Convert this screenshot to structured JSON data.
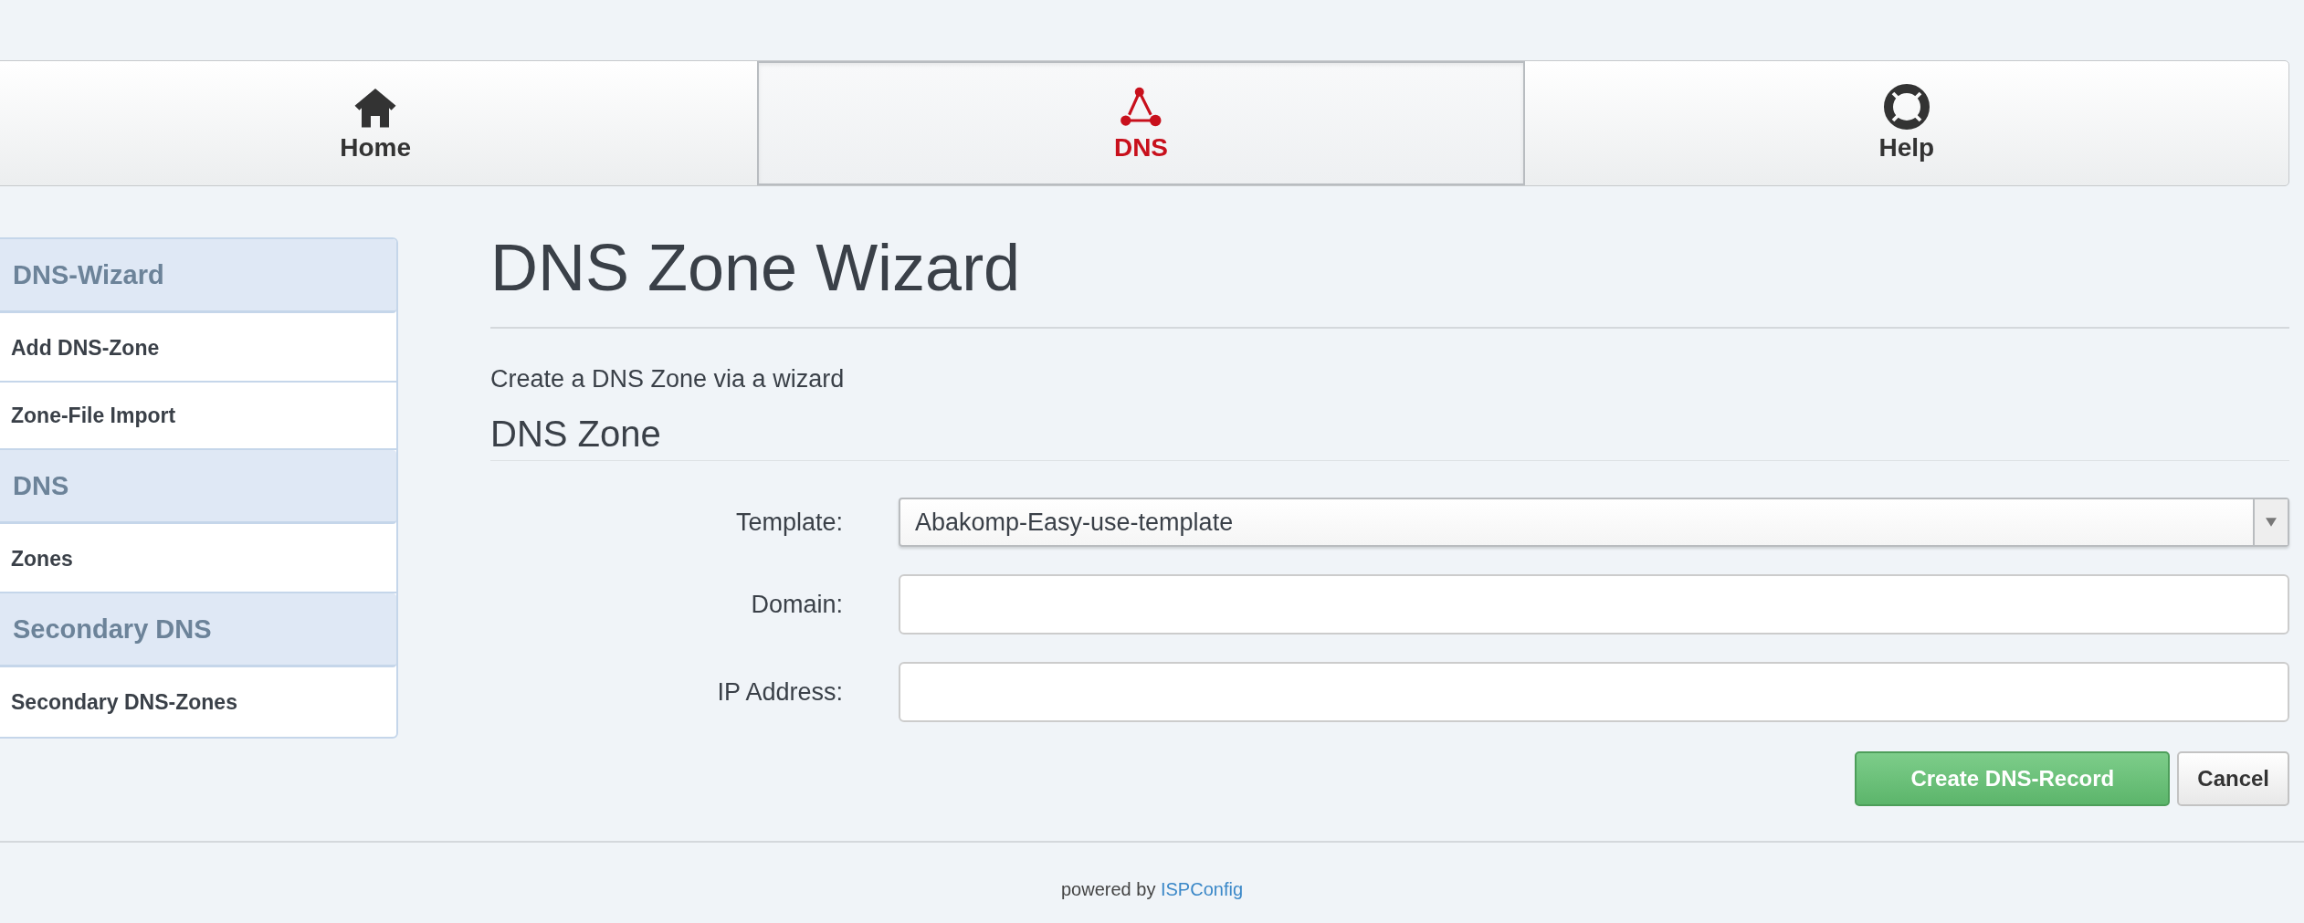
{
  "nav": {
    "tabs": [
      {
        "label": "Home",
        "selected": false
      },
      {
        "label": "DNS",
        "selected": true
      },
      {
        "label": "Help",
        "selected": false
      }
    ]
  },
  "sidebar": {
    "items": [
      {
        "kind": "header",
        "label": "DNS-Wizard"
      },
      {
        "kind": "link",
        "label": "Add DNS-Zone"
      },
      {
        "kind": "link",
        "label": "Zone-File Import"
      },
      {
        "kind": "header",
        "label": "DNS"
      },
      {
        "kind": "link",
        "label": "Zones"
      },
      {
        "kind": "header",
        "label": "Secondary DNS"
      },
      {
        "kind": "link",
        "label": "Secondary DNS-Zones"
      }
    ]
  },
  "page": {
    "title": "DNS Zone Wizard",
    "description": "Create a DNS Zone via a wizard",
    "section": "DNS Zone"
  },
  "form": {
    "fields": [
      {
        "kind": "select",
        "label": "Template:",
        "value": "Abakomp-Easy-use-template"
      },
      {
        "kind": "text",
        "label": "Domain:"
      },
      {
        "kind": "text",
        "label": "IP Address:"
      }
    ],
    "buttons": [
      {
        "kind": "primary",
        "label": "Create DNS-Record"
      },
      {
        "kind": "default",
        "label": "Cancel"
      }
    ]
  },
  "footer": {
    "text": "powered by",
    "link": "ISPConfig"
  }
}
